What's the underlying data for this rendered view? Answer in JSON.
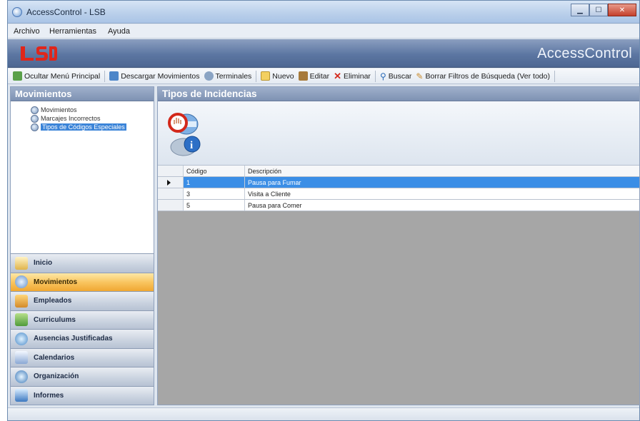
{
  "window": {
    "title": "AccessControl - LSB"
  },
  "menubar": {
    "items": [
      "Archivo",
      "Herramientas",
      "Ayuda"
    ]
  },
  "banner": {
    "logo_text": "LSB",
    "app_name": "AccessControl"
  },
  "toolbar": {
    "items": [
      {
        "label": "Ocultar Menú Principal",
        "icon": "hide-menu-icon"
      },
      {
        "label": "Descargar Movimientos",
        "icon": "download-icon"
      },
      {
        "label": "Terminales",
        "icon": "terminal-icon"
      },
      {
        "label": "Nuevo",
        "icon": "new-doc-icon"
      },
      {
        "label": "Editar",
        "icon": "edit-icon"
      },
      {
        "label": "Eliminar",
        "icon": "delete-icon"
      },
      {
        "label": "Buscar",
        "icon": "search-icon"
      },
      {
        "label": "Borrar Filtros de Búsqueda (Ver todo)",
        "icon": "clear-filter-icon"
      }
    ]
  },
  "left_panel": {
    "title": "Movimientos",
    "tree": [
      {
        "label": "Movimientos",
        "selected": false
      },
      {
        "label": "Marcajes Incorrectos",
        "selected": false
      },
      {
        "label": "Tipos de Códigos Especiales",
        "selected": true
      }
    ],
    "nav": [
      {
        "label": "Inicio",
        "active": false
      },
      {
        "label": "Movimientos",
        "active": true
      },
      {
        "label": "Empleados",
        "active": false
      },
      {
        "label": "Curriculums",
        "active": false
      },
      {
        "label": "Ausencias Justificadas",
        "active": false
      },
      {
        "label": "Calendarios",
        "active": false
      },
      {
        "label": "Organización",
        "active": false
      },
      {
        "label": "Informes",
        "active": false
      }
    ]
  },
  "right_panel": {
    "title": "Tipos de Incidencias",
    "grid": {
      "columns": [
        "Código",
        "Descripción"
      ],
      "rows": [
        {
          "codigo": "1",
          "descripcion": "Pausa para Fumar",
          "selected": true
        },
        {
          "codigo": "3",
          "descripcion": "Visita a Cliente",
          "selected": false
        },
        {
          "codigo": "5",
          "descripcion": "Pausa para Comer",
          "selected": false
        }
      ]
    }
  },
  "colors": {
    "banner": "#5c76a2",
    "nav_active": "#f9c560",
    "selection": "#3b8ee6",
    "grid_background": "#a6a6a6"
  }
}
